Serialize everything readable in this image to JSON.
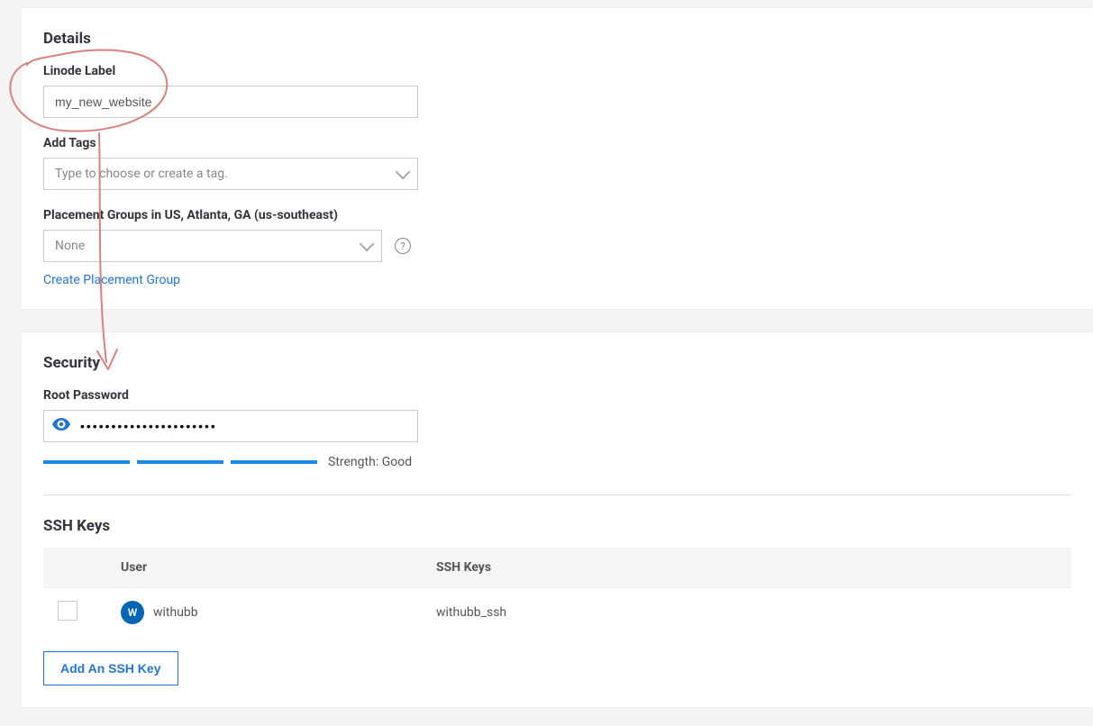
{
  "details": {
    "title": "Details",
    "linode_label": {
      "label": "Linode Label",
      "value": "my_new_website"
    },
    "tags": {
      "label": "Add Tags",
      "placeholder": "Type to choose or create a tag."
    },
    "placement": {
      "label": "Placement Groups in US, Atlanta, GA (us-southeast)",
      "selected": "None",
      "create_link": "Create Placement Group"
    }
  },
  "security": {
    "title": "Security",
    "root_password": {
      "label": "Root Password",
      "value": "••••••••••••••••••••••",
      "strength_prefix": "Strength: ",
      "strength_value": "Good"
    },
    "ssh": {
      "title": "SSH Keys",
      "columns": {
        "user": "User",
        "keys": "SSH Keys"
      },
      "row": {
        "avatar_initial": "W",
        "username": "withubb",
        "key_name": "withubb_ssh"
      },
      "add_button": "Add An SSH Key"
    }
  }
}
